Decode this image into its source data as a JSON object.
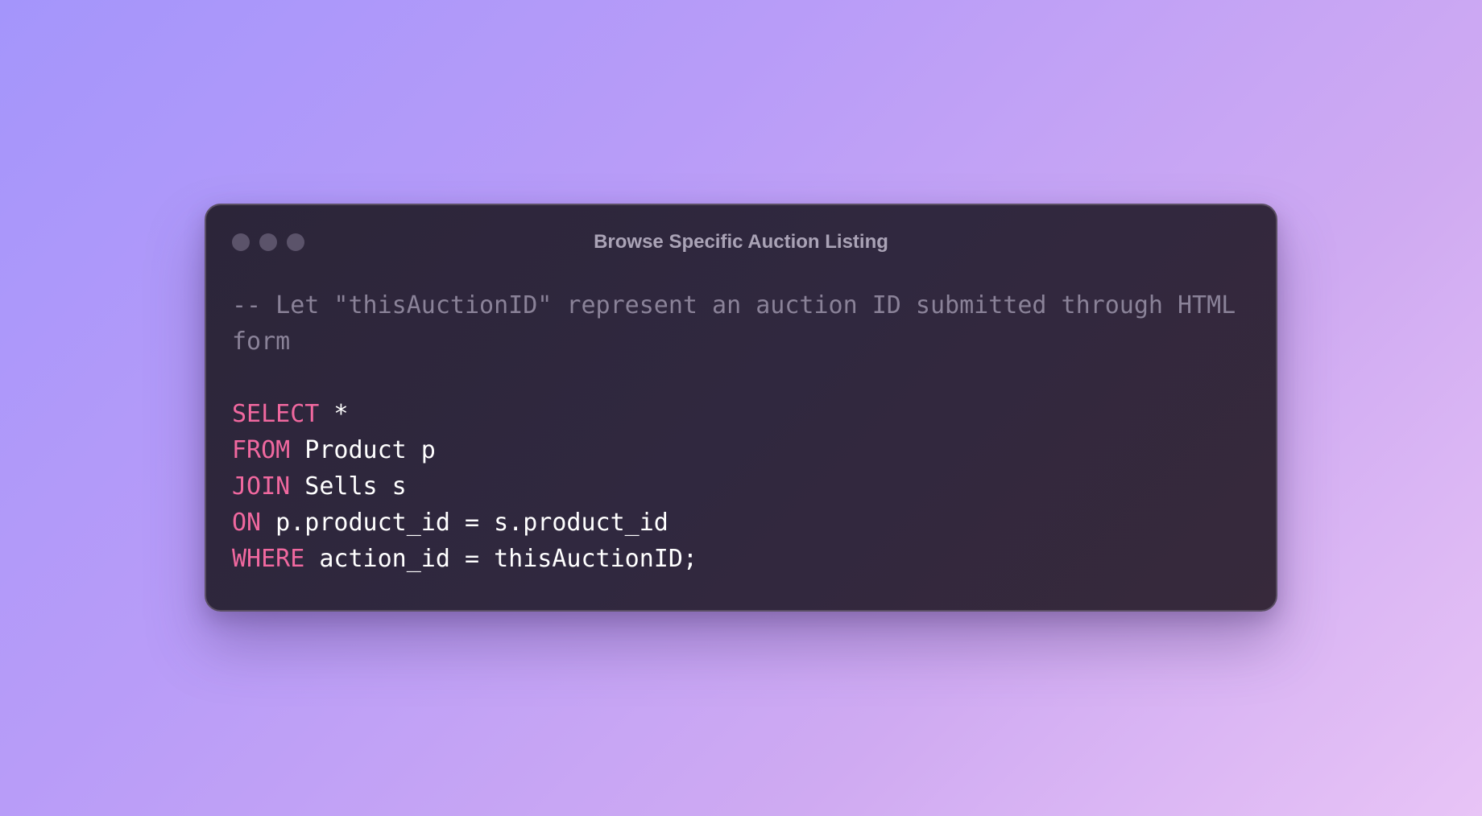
{
  "window": {
    "title": "Browse Specific Auction Listing",
    "controls": [
      "close-dot",
      "minimize-dot",
      "maximize-dot"
    ]
  },
  "code": {
    "language": "sql",
    "comment_line1": "-- Let \"thisAuctionID\" represent an auction ID submitted through HTML",
    "comment_line2": "form",
    "lines": [
      {
        "keyword": "SELECT",
        "rest": " *"
      },
      {
        "keyword": "FROM",
        "rest": " Product p"
      },
      {
        "keyword": "JOIN",
        "rest": " Sells s"
      },
      {
        "keyword": "ON",
        "rest": " p.product_id = s.product_id"
      },
      {
        "keyword": "WHERE",
        "rest": " action_id = thisAuctionID;"
      }
    ]
  },
  "colors": {
    "keyword": "#f0689f",
    "comment": "#8a8298",
    "text": "#ffffff",
    "window_bg": "#2e2739",
    "title": "#aaa3b6"
  }
}
